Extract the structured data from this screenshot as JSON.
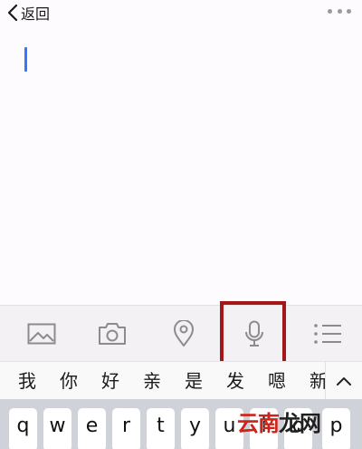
{
  "nav": {
    "back_label": "返回",
    "back_icon": "chevron-left-icon",
    "more_icon": "more-dots-icon"
  },
  "editor": {
    "text": "",
    "cursor_color": "#2f7bf5"
  },
  "toolbar": {
    "items": [
      {
        "name": "image",
        "icon": "image-icon"
      },
      {
        "name": "camera",
        "icon": "camera-icon"
      },
      {
        "name": "location",
        "icon": "location-pin-icon"
      },
      {
        "name": "voice",
        "icon": "microphone-icon",
        "highlighted": true
      },
      {
        "name": "list",
        "icon": "list-icon"
      }
    ],
    "highlight_color": "#a31717"
  },
  "candidates": {
    "words": [
      "我",
      "你",
      "好",
      "亲",
      "是",
      "发",
      "嗯",
      "新"
    ],
    "collapse_icon": "chevron-up-icon"
  },
  "keyboard": {
    "row1": [
      "q",
      "w",
      "e",
      "r",
      "t",
      "y",
      "u",
      "i",
      "o",
      "p"
    ]
  },
  "watermark": {
    "part1": "云南",
    "part2": "龙网"
  }
}
